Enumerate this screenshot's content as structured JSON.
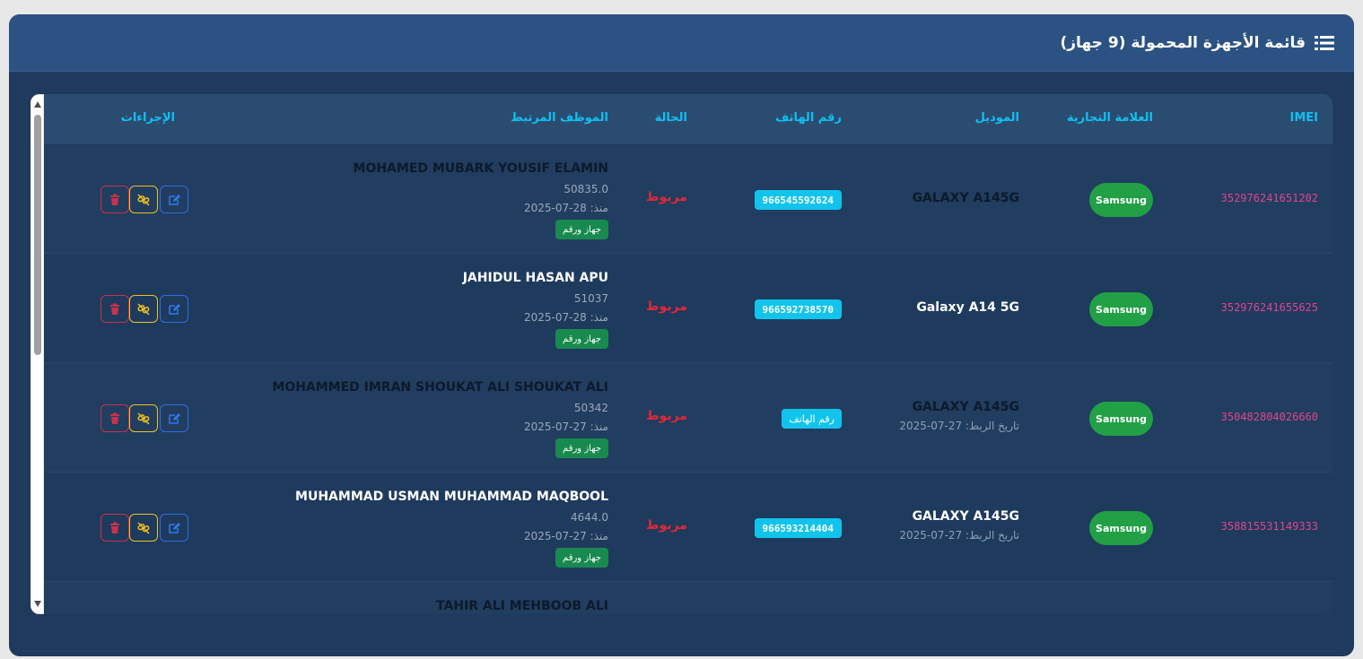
{
  "header": {
    "title": "قائمة الأجهزة المحمولة (9 جهاز)",
    "icon": "list-icon"
  },
  "columns": {
    "imei": "IMEI",
    "brand": "العلامة التجارية",
    "model": "الموديل",
    "phone": "رقم الهاتف",
    "status": "الحالة",
    "employee": "الموظف المرتبط",
    "actions": "الإجراءات"
  },
  "rows": [
    {
      "imei": "352976241651202",
      "brand": "Samsung",
      "model": "GALAXY A145G",
      "link_date": "",
      "phone": "966545592624",
      "status": "مربوط",
      "employee_name": "MOHAMED MUBARK YOUSIF ELAMIN",
      "employee_number": "50835.0",
      "since": "منذ: 28-07-2025",
      "badge": "جهاز ورقم"
    },
    {
      "imei": "352976241655625",
      "brand": "Samsung",
      "model": "Galaxy A14 5G",
      "link_date": "",
      "phone": "966592738570",
      "status": "مربوط",
      "employee_name": "JAHIDUL HASAN APU",
      "employee_number": "51037",
      "since": "منذ: 28-07-2025",
      "badge": "جهاز ورقم"
    },
    {
      "imei": "350482804026660",
      "brand": "Samsung",
      "model": "GALAXY A145G",
      "link_date": "تاريخ الربط: 27-07-2025",
      "phone": "رقم الهاتف",
      "status": "مربوط",
      "employee_name": "MOHAMMED IMRAN SHOUKAT ALI SHOUKAT ALI",
      "employee_number": "50342",
      "since": "منذ: 27-07-2025",
      "badge": "جهاز ورقم"
    },
    {
      "imei": "358815531149333",
      "brand": "Samsung",
      "model": "GALAXY A145G",
      "link_date": "تاريخ الربط: 27-07-2025",
      "phone": "966593214404",
      "status": "مربوط",
      "employee_name": "MUHAMMAD USMAN MUHAMMAD MAQBOOL",
      "employee_number": "4644.0",
      "since": "منذ: 27-07-2025",
      "badge": "جهاز ورقم"
    },
    {
      "employee_name": "TAHIR ALI MEHBOOB ALI"
    }
  ],
  "colors": {
    "accent": "#11c0f0",
    "imei": "#e0458e",
    "brand_pill": "#21a046",
    "status": "#e0283a",
    "phone_badge": "#12c4ec",
    "employee_badge": "#188a4f"
  },
  "icons": {
    "edit": "edit-icon",
    "unlink": "unlink-icon",
    "delete": "trash-icon"
  }
}
